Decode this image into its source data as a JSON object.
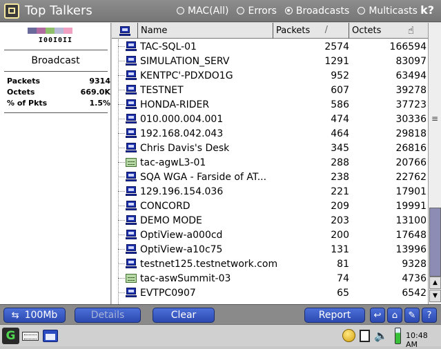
{
  "window": {
    "title": "Top Talkers"
  },
  "modes": [
    {
      "label": "MAC(All)",
      "selected": false
    },
    {
      "label": "Errors",
      "selected": false
    },
    {
      "label": "Broadcasts",
      "selected": true
    },
    {
      "label": "Multicasts",
      "selected": false
    }
  ],
  "left_panel": {
    "swatch_colors": [
      "#6a6a9a",
      "#b06aa0",
      "#8fbf6a",
      "#b8b8d8",
      "#f0a0c0"
    ],
    "binary": "I00I0II",
    "section_title": "Broadcast",
    "stats": [
      {
        "label": "Packets",
        "value": "9314"
      },
      {
        "label": "Octets",
        "value": "669.0K"
      },
      {
        "label": "% of Pkts",
        "value": "1.5%"
      }
    ]
  },
  "table": {
    "columns": {
      "name": "Name",
      "packets": "Packets",
      "packets_sort": "/",
      "octets": "Octets"
    },
    "rows": [
      {
        "icon": "pc",
        "name": "TAC-SQL-01",
        "packets": "2574",
        "octets": "166594"
      },
      {
        "icon": "pc",
        "name": "SIMULATION_SERV",
        "packets": "1291",
        "octets": "83097"
      },
      {
        "icon": "pc",
        "name": "KENTPC'-PDXDO1G",
        "packets": "952",
        "octets": "63494"
      },
      {
        "icon": "pc",
        "name": "TESTNET",
        "packets": "607",
        "octets": "39278"
      },
      {
        "icon": "pc",
        "name": "HONDA-RIDER",
        "packets": "586",
        "octets": "37723"
      },
      {
        "icon": "pc",
        "name": "010.000.004.001",
        "packets": "474",
        "octets": "30336"
      },
      {
        "icon": "pc",
        "name": "192.168.042.043",
        "packets": "464",
        "octets": "29818"
      },
      {
        "icon": "pc",
        "name": "Chris Davis's Desk",
        "packets": "345",
        "octets": "26816"
      },
      {
        "icon": "switch",
        "name": "tac-agwL3-01",
        "packets": "288",
        "octets": "20766"
      },
      {
        "icon": "pc",
        "name": "SQA WGA - Farside of AT...",
        "packets": "238",
        "octets": "22762"
      },
      {
        "icon": "pc",
        "name": "129.196.154.036",
        "packets": "221",
        "octets": "17901"
      },
      {
        "icon": "pc",
        "name": "CONCORD",
        "packets": "209",
        "octets": "19991"
      },
      {
        "icon": "pc",
        "name": "DEMO MODE",
        "packets": "203",
        "octets": "13100"
      },
      {
        "icon": "pc",
        "name": "OptiView-a000cd",
        "packets": "200",
        "octets": "17648"
      },
      {
        "icon": "pc",
        "name": "OptiView-a10c75",
        "packets": "131",
        "octets": "13996"
      },
      {
        "icon": "pc",
        "name": "testnet125.testnetwork.com",
        "packets": "81",
        "octets": "9328"
      },
      {
        "icon": "switch",
        "name": "tac-aswSummit-03",
        "packets": "74",
        "octets": "4736"
      },
      {
        "icon": "pc",
        "name": "EVTPC0907",
        "packets": "65",
        "octets": "6542"
      }
    ]
  },
  "buttons": {
    "speed": "100Mb",
    "details": "Details",
    "clear": "Clear",
    "report": "Report"
  },
  "taskbar": {
    "clock": "10:48 AM",
    "start": "G"
  }
}
